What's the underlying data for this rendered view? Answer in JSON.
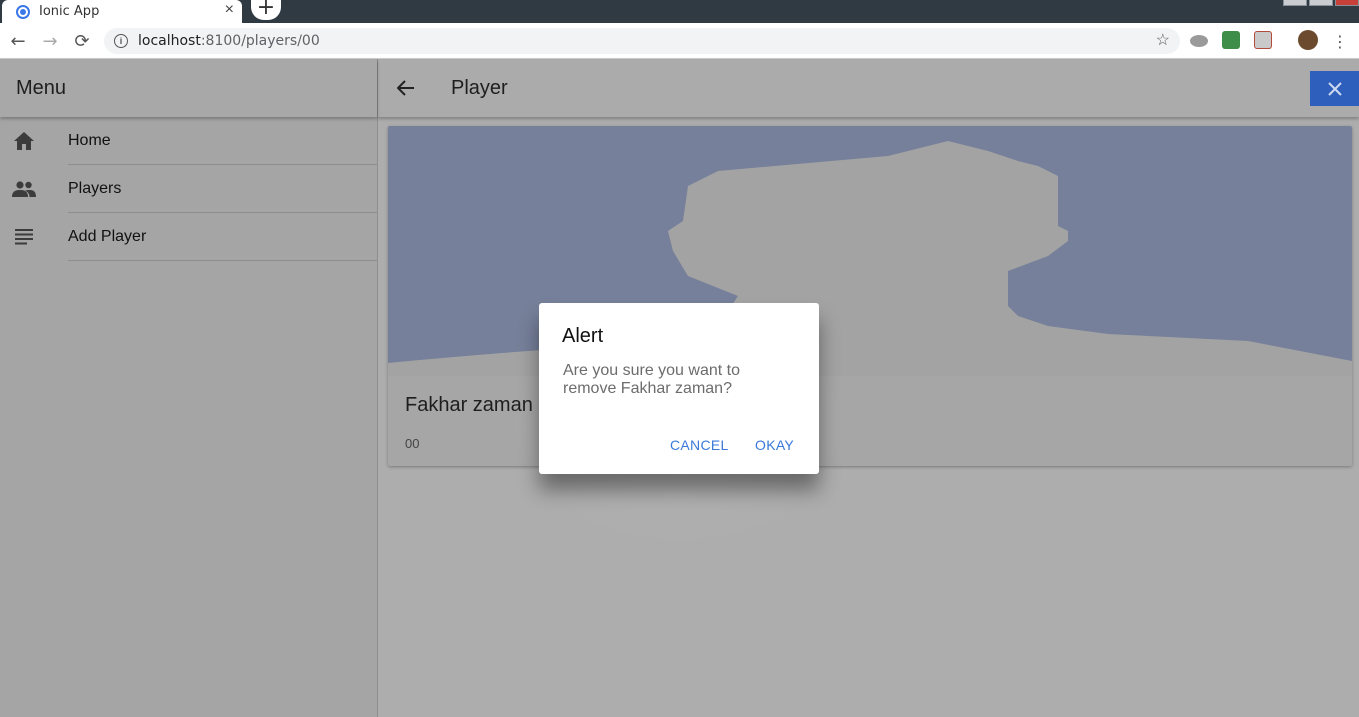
{
  "browser": {
    "tab_title": "Ionic App",
    "tab_close": "×",
    "new_tab": "+",
    "url_host": "localhost",
    "url_path": ":8100/players/00",
    "nav": {
      "back": "←",
      "forward": "→",
      "reload": "⟳"
    },
    "star": "☆",
    "more": "⋮"
  },
  "menu": {
    "title": "Menu",
    "items": [
      {
        "label": "Home",
        "icon": "home-icon"
      },
      {
        "label": "Players",
        "icon": "people-icon"
      },
      {
        "label": "Add Player",
        "icon": "list-icon"
      }
    ]
  },
  "header": {
    "title": "Player",
    "back_icon": "arrow-back-icon",
    "close_icon": "close-icon"
  },
  "player_card": {
    "name": "Fakhar zaman",
    "number": "00"
  },
  "alert": {
    "title": "Alert",
    "message": "Are you sure you want to remove Fakhar zaman?",
    "cancel_label": "CANCEL",
    "okay_label": "OKAY"
  },
  "colors": {
    "accent": "#3a79d9",
    "close_button": "#2f5fbd",
    "silhouette_bg": "#76809a"
  }
}
